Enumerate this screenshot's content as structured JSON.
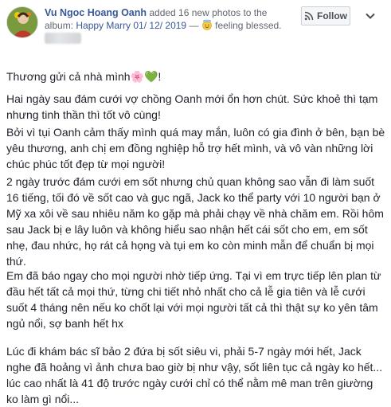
{
  "post": {
    "author_name": "Vu Ngoc Hoang Oanh",
    "action_text": " added 16 new photos to the album: ",
    "album_title": "Happy Marry 01/ 12/ 2019",
    "dash": " — ",
    "feeling_text": " feeling blessed.",
    "follow_label": "Follow",
    "icons": {
      "avatar": "avatar-photo",
      "follow": "follow-rss-icon",
      "more": "chevron-down-icon",
      "feeling": "blessed-emoji-icon",
      "privacy": "blurred-timestamp"
    },
    "paragraphs": [
      "Thương gửi cả nhà mình🌸💚!",
      "Hai ngày sau đám cưới vợ chồng Oanh mới ổn hơn chút. Sức khoẻ thì tạm nhưng tinh thần thì tốt vô cùng!",
      "Bởi vì tụi Oanh cảm thấy mình quá may mắn, luôn có gia đình ở bên, bạn bè yêu thương, anh chị em đồng nghiệp hỗ trợ hết mình, và vô vàn những lời chúc phúc tốt đẹp từ mọi người!",
      "2 ngày trước đám cưới em sốt nhưng chủ quan không sao vẫn đi làm suốt 16 tiếng, tối đó về sốt cao và gục ngã, Jack ko thể party với 10 người bạn ở Mỹ xa xôi về sau nhiêu năm ko gặp mà phải chạy về nhà chăm em. Rồi hôm sau Jack bị e lây luôn và không hiểu sao nhận hết cái sốt cho em, em sốt nhẹ, đau nhức, họ rát cả họng và tụi em ko còn minh mẫn để chuẩn bị mọi thứ.",
      "Em đã báo ngay cho mọi người nhờ tiếp ứng. Tại vì em trực tiếp lên plan từ đầu hết tất cả mọi thứ, từng chi tiết nhỏ nhất cho cả lễ gia tiên và lễ cưới suốt 4 tháng nên nếu ko chốt lại với mọi người tất cả thì thật sự ko yên tâm ngủ nổi, sợ banh hết hx",
      "Lúc đi khám bác sĩ bảo 2 đứa bị sốt siêu vi, phải 5-7 ngày mới hết, Jack nghe đã hoảng vì ảnh chưa bao giờ bị như vậy, sốt liên tục cả ngày ko hết... lúc cao nhất là 41 độ trước ngày cưới chỉ có thể nằm mê man trên giường ko làm gì nổi..."
    ]
  }
}
